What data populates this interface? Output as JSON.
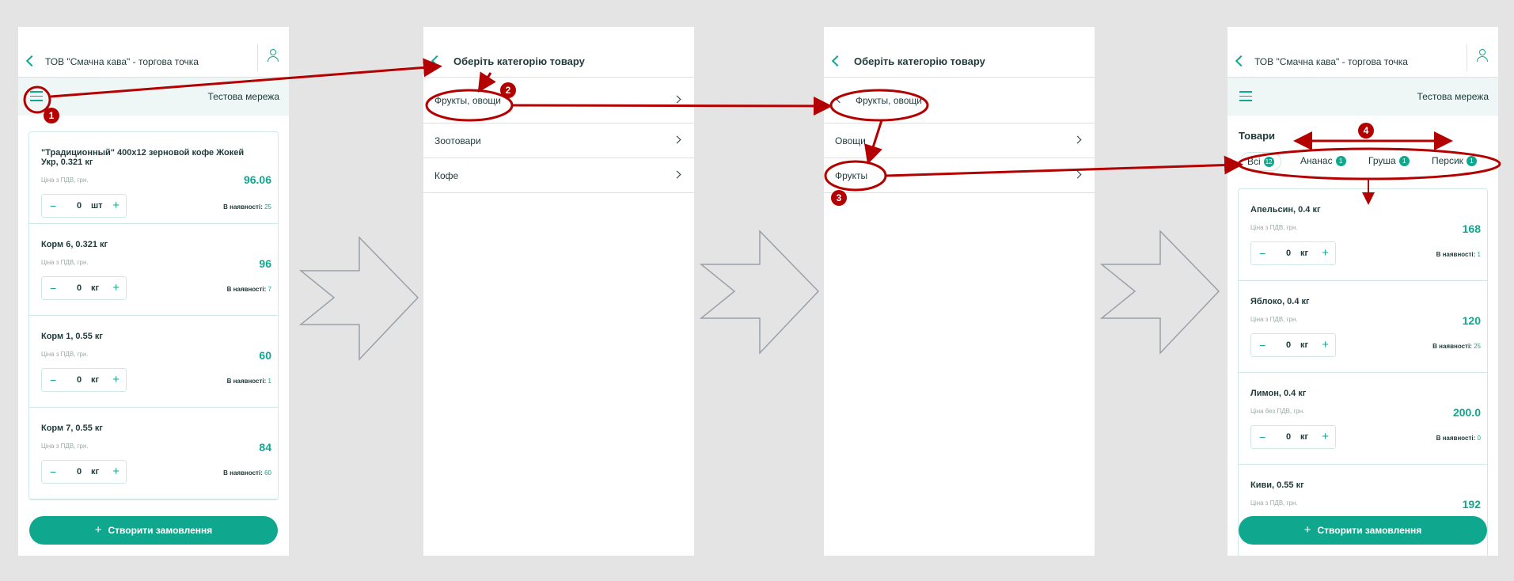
{
  "colors": {
    "accent": "#0fa88f",
    "annotation": "#b30000",
    "border": "#cfe8e5"
  },
  "screen1": {
    "header_title": "ТОВ \"Смачна кава\" - торгова точка",
    "network": "Тестова мережа",
    "products": [
      {
        "name": "\"Традиционный\"  400x12 зерновой кофе Жокей Укр, 0.321 кг",
        "price_label": "Ціна з ПДВ, грн.",
        "price": "96.06",
        "qty": "0",
        "unit": "шт",
        "stock_label": "В наявності:",
        "stock": "25"
      },
      {
        "name": "Корм 6, 0.321 кг",
        "price_label": "Ціна з ПДВ, грн.",
        "price": "96",
        "qty": "0",
        "unit": "кг",
        "stock_label": "В наявності:",
        "stock": "7"
      },
      {
        "name": "Корм 1, 0.55 кг",
        "price_label": "Ціна з ПДВ, грн.",
        "price": "60",
        "qty": "0",
        "unit": "кг",
        "stock_label": "В наявності:",
        "stock": "1"
      },
      {
        "name": "Корм 7, 0.55 кг",
        "price_label": "Ціна з ПДВ, грн.",
        "price": "84",
        "qty": "0",
        "unit": "кг",
        "stock_label": "В наявності:",
        "stock": "60"
      }
    ],
    "create_order": "Створити замовлення"
  },
  "screen2": {
    "header_title": "Оберіть категорію товару",
    "categories": [
      "Фрукты, овощи",
      "Зоотовари",
      "Кофе"
    ]
  },
  "screen3": {
    "header_title": "Оберіть категорію товару",
    "parent": "Фрукты, овощи",
    "categories": [
      "Овощи",
      "Фрукты"
    ]
  },
  "screen4": {
    "header_title": "ТОВ \"Смачна кава\" - торгова точка",
    "network": "Тестова мережа",
    "goods_title": "Товари",
    "tabs": [
      {
        "label": "Всі",
        "count": "12"
      },
      {
        "label": "Ананас",
        "count": "1"
      },
      {
        "label": "Груша",
        "count": "1"
      },
      {
        "label": "Персик",
        "count": "1"
      }
    ],
    "products": [
      {
        "name": "Апельсин, 0.4 кг",
        "price_label": "Ціна з ПДВ, грн.",
        "price": "168",
        "qty": "0",
        "unit": "кг",
        "stock_label": "В наявності:",
        "stock": "1"
      },
      {
        "name": "Яблоко, 0.4 кг",
        "price_label": "Ціна з ПДВ, грн.",
        "price": "120",
        "qty": "0",
        "unit": "кг",
        "stock_label": "В наявності:",
        "stock": "25"
      },
      {
        "name": "Лимон, 0.4 кг",
        "price_label": "Ціна без ПДВ, грн.",
        "price": "200.0",
        "qty": "0",
        "unit": "кг",
        "stock_label": "В наявності:",
        "stock": "0"
      },
      {
        "name": "Киви, 0.55 кг",
        "price_label": "Ціна з ПДВ, грн.",
        "price": "192"
      }
    ],
    "create_order": "Створити замовлення"
  },
  "annotations": [
    "1",
    "2",
    "3",
    "4"
  ]
}
